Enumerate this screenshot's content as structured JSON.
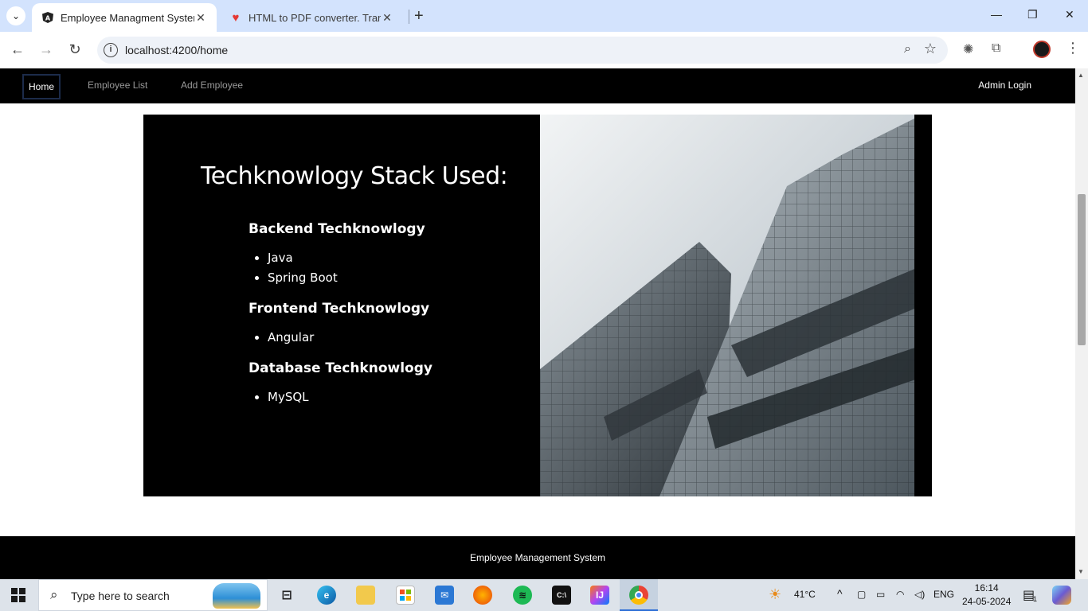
{
  "browser": {
    "tabs": [
      {
        "title": "Employee Managment System",
        "active": true
      },
      {
        "title": "HTML to PDF converter. Transfo",
        "active": false
      }
    ],
    "url": "localhost:4200/home"
  },
  "app": {
    "nav": {
      "home": "Home",
      "employee_list": "Employee List",
      "add_employee": "Add Employee",
      "admin_login": "Admin Login"
    },
    "hero": {
      "title": "Techknowlogy Stack Used:",
      "sections": [
        {
          "heading": "Backend Techknowlogy",
          "items": [
            "Java",
            "Spring Boot"
          ]
        },
        {
          "heading": "Frontend Techknowlogy",
          "items": [
            "Angular"
          ]
        },
        {
          "heading": "Database Techknowlogy",
          "items": [
            "MySQL"
          ]
        }
      ]
    },
    "footer": "Employee Management System"
  },
  "taskbar": {
    "search_placeholder": "Type here to search",
    "weather": "41°C",
    "language": "ENG",
    "time": "16:14",
    "date": "24-05-2024",
    "notification_count": "1"
  }
}
